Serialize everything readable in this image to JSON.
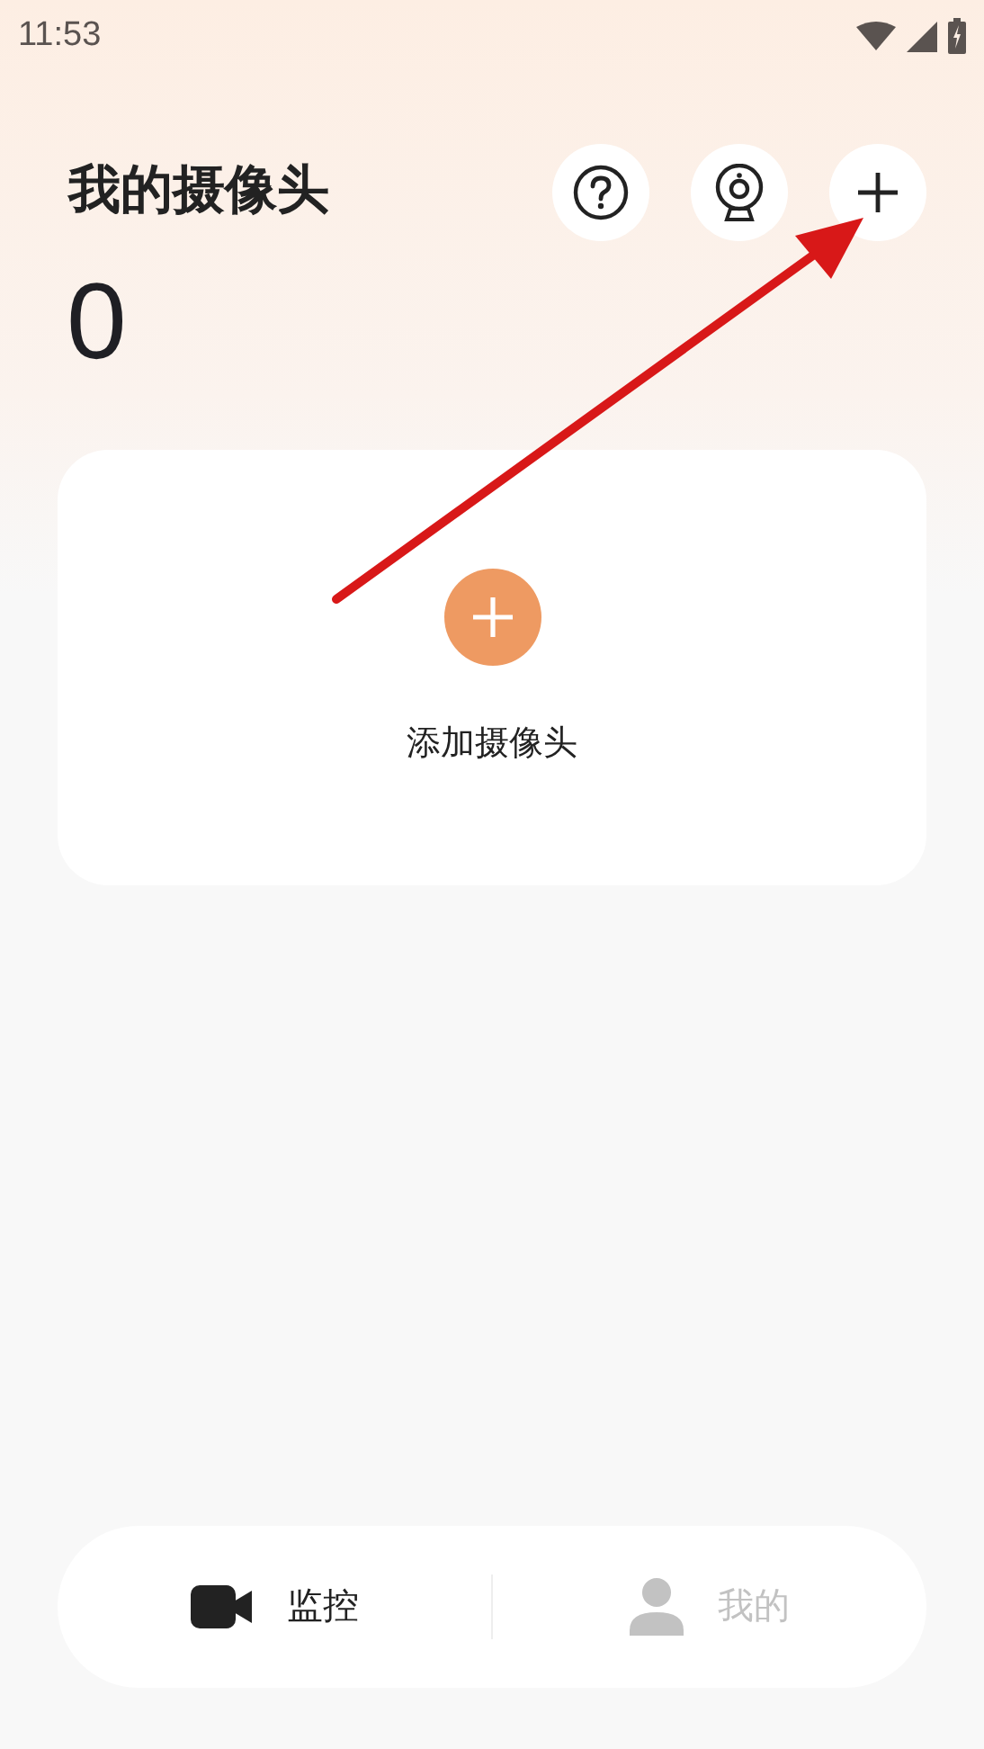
{
  "status_bar": {
    "time": "11:53"
  },
  "header": {
    "title": "我的摄像头",
    "count": "0"
  },
  "add_card": {
    "label": "添加摄像头"
  },
  "bottom_nav": [
    {
      "label": "监控",
      "selected": true
    },
    {
      "label": "我的",
      "selected": false
    }
  ]
}
